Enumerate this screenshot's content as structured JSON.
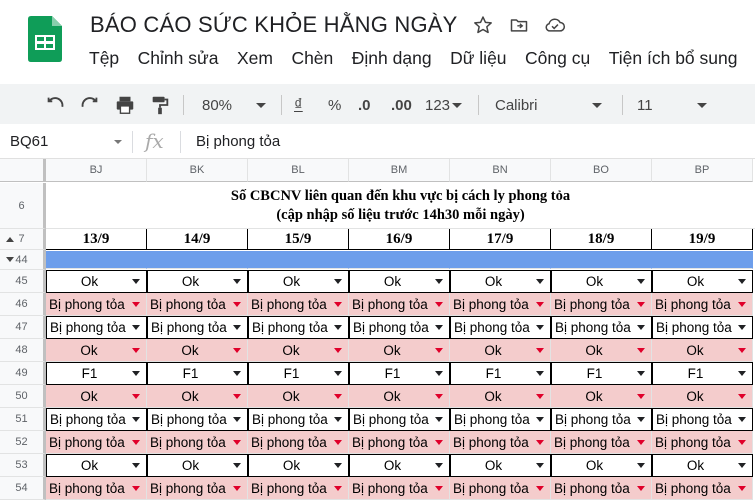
{
  "app": {
    "title": "BÁO CÁO SỨC KHỎE HẰNG NGÀY",
    "brand_color": "#0f9d58"
  },
  "menu": [
    "Tệp",
    "Chỉnh sửa",
    "Xem",
    "Chèn",
    "Định dạng",
    "Dữ liệu",
    "Công cụ",
    "Tiện ích bổ sung"
  ],
  "toolbar": {
    "zoom": "80%",
    "currency": "₫",
    "percent": "%",
    "dec_decrease": ".0",
    "dec_increase": ".00",
    "format": "123",
    "font": "Calibri",
    "font_size": "11"
  },
  "formula_bar": {
    "cell_ref": "BQ61",
    "fx": "fx",
    "content": "Bị phong tỏa"
  },
  "sheet": {
    "columns": [
      "BJ",
      "BK",
      "BL",
      "BM",
      "BN",
      "BO",
      "BP"
    ],
    "merged_title_line1": "Số CBCNV liên quan đến khu vực bị cách ly phong tỏa",
    "merged_title_line2": "(cập nhập số liệu trước 14h30 mỗi ngày)",
    "dates": [
      "13/9",
      "14/9",
      "15/9",
      "16/9",
      "17/9",
      "18/9",
      "19/9"
    ],
    "row_headers": {
      "r6": "6",
      "r7": "7",
      "r44": "44",
      "r45": "45",
      "r46": "46",
      "r47": "47",
      "r48": "48",
      "r49": "49",
      "r50": "50",
      "r51": "51",
      "r52": "52",
      "r53": "53",
      "r54": "54"
    },
    "rows": [
      {
        "row": "45",
        "value": "Ok",
        "bg": "white",
        "arrow": "black"
      },
      {
        "row": "46",
        "value": "Bị phong tỏa",
        "bg": "pink",
        "arrow": "red"
      },
      {
        "row": "47",
        "value": "Bị phong tỏa",
        "bg": "white",
        "arrow": "black"
      },
      {
        "row": "48",
        "value": "Ok",
        "bg": "pink",
        "arrow": "red"
      },
      {
        "row": "49",
        "value": "F1",
        "bg": "white",
        "arrow": "black"
      },
      {
        "row": "50",
        "value": "Ok",
        "bg": "pink",
        "arrow": "red"
      },
      {
        "row": "51",
        "value": "Bị phong tỏa",
        "bg": "white",
        "arrow": "black"
      },
      {
        "row": "52",
        "value": "Bị phong tỏa",
        "bg": "pink",
        "arrow": "red"
      },
      {
        "row": "53",
        "value": "Ok",
        "bg": "white",
        "arrow": "black"
      },
      {
        "row": "54",
        "value": "Bị phong tỏa",
        "bg": "pink",
        "arrow": "red"
      }
    ],
    "header_row_color": "#6d9eeb",
    "pink_color": "#f4cccc"
  }
}
